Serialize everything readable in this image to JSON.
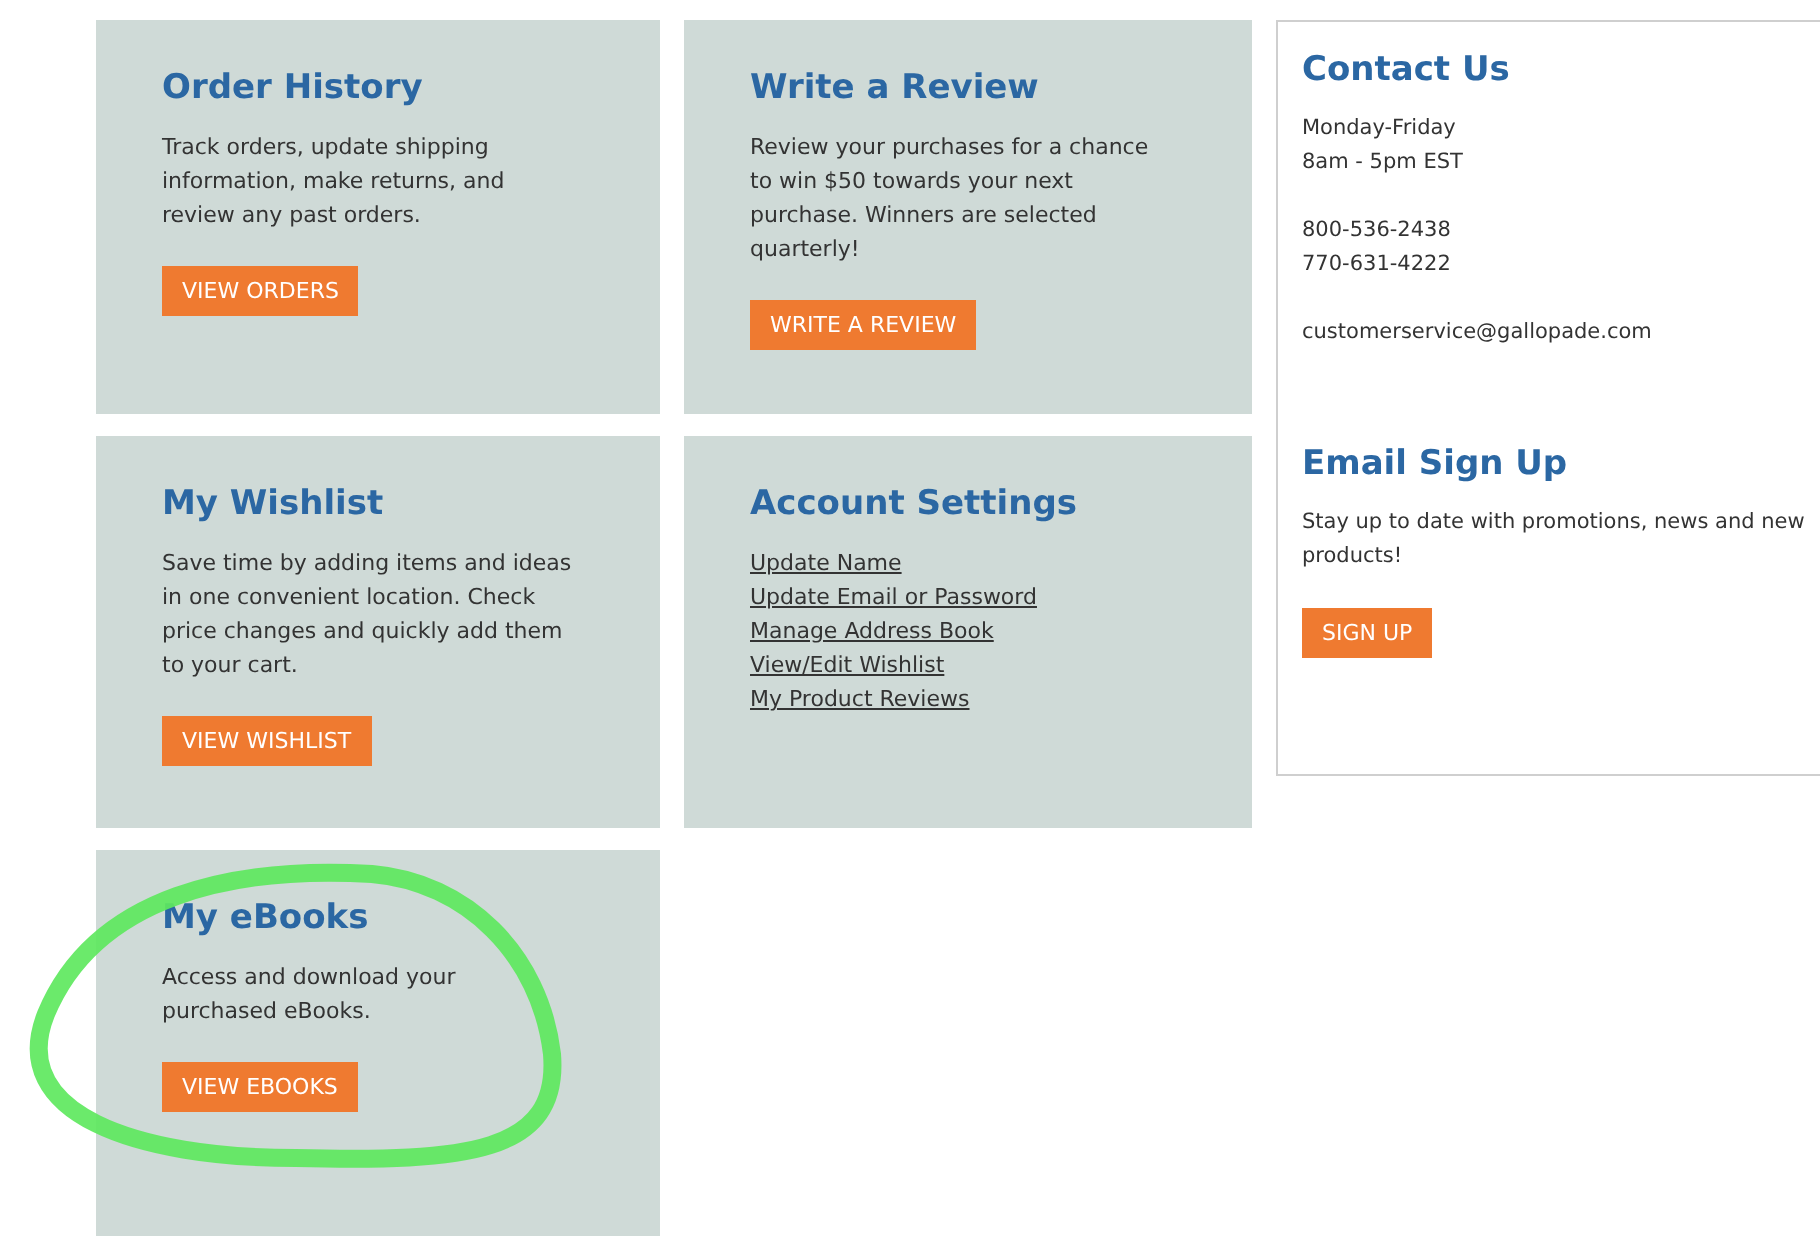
{
  "cards": [
    {
      "kind": "text",
      "title": "Order History",
      "text": "Track orders, update shipping information, make returns, and review any past orders.",
      "button": "VIEW ORDERS"
    },
    {
      "kind": "text",
      "title": "Write a Review",
      "text": "Review your purchases for a chance to win $50 towards your next purchase. Winners are selected quarterly!",
      "button": "WRITE A REVIEW"
    },
    {
      "kind": "text",
      "title": "My Wishlist",
      "text": "Save time by adding items and ideas in one convenient location. Check price changes and quickly add them to your cart.",
      "button": "VIEW WISHLIST"
    },
    {
      "kind": "links",
      "title": "Account Settings",
      "links": [
        "Update Name",
        "Update Email or Password",
        "Manage Address Book",
        "View/Edit Wishlist",
        "My Product Reviews"
      ]
    },
    {
      "kind": "text",
      "title": "My eBooks",
      "text": "Access and download your purchased eBooks.",
      "button": "VIEW EBOOKS",
      "highlighted": true
    }
  ],
  "contact": {
    "title": "Contact Us",
    "lines": [
      [
        "Monday-Friday",
        "8am - 5pm EST"
      ],
      [
        "800-536-2438",
        "770-631-4222"
      ],
      [
        "customerservice@gallopade.com"
      ]
    ]
  },
  "signup": {
    "title": "Email Sign Up",
    "text": "Stay up to date with promotions, news and new products!",
    "button": "SIGN UP"
  }
}
